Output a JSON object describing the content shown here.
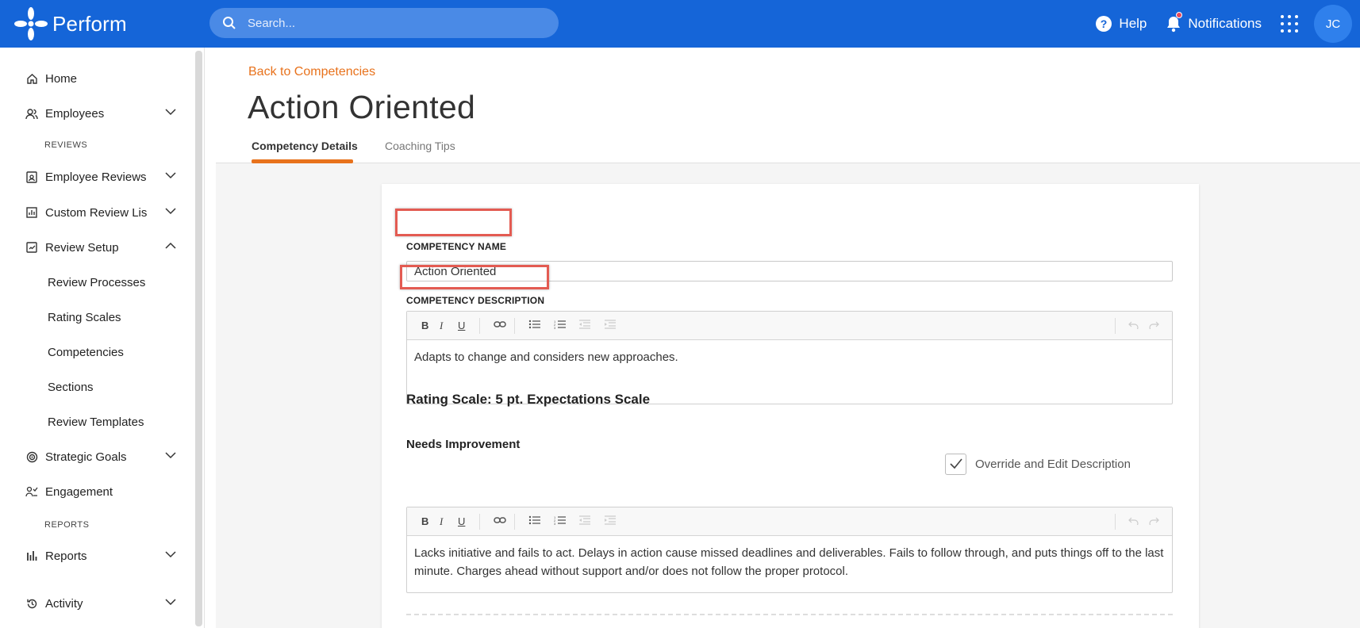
{
  "app": {
    "name": "Perform"
  },
  "search": {
    "placeholder": "Search..."
  },
  "topbar": {
    "help_label": "Help",
    "notifications_label": "Notifications",
    "avatar_initials": "JC"
  },
  "sidebar": {
    "home": "Home",
    "employees": "Employees",
    "section_reviews": "REVIEWS",
    "employee_reviews": "Employee Reviews",
    "custom_review_lists": "Custom Review Lis",
    "review_setup": "Review Setup",
    "review_processes": "Review Processes",
    "rating_scales": "Rating Scales",
    "competencies": "Competencies",
    "sections": "Sections",
    "review_templates": "Review Templates",
    "strategic_goals": "Strategic Goals",
    "engagement": "Engagement",
    "section_reports": "REPORTS",
    "reports": "Reports",
    "activity": "Activity"
  },
  "page": {
    "back_link": "Back to Competencies",
    "title": "Action Oriented",
    "tabs": [
      "Competency Details",
      "Coaching Tips"
    ]
  },
  "form": {
    "name_label": "COMPETENCY NAME",
    "name_value": "Action Oriented",
    "description_label": "COMPETENCY DESCRIPTION",
    "description_text": "Adapts to change and considers new approaches.",
    "rating_scale_heading": "Rating Scale: 5 pt. Expectations Scale",
    "level_name": "Needs Improvement",
    "override_label": "Override and Edit Description",
    "override_checked": true,
    "level_description": "Lacks initiative and fails to act. Delays in action cause missed deadlines and deliverables.  Fails to follow through, and puts things off to the last minute. Charges ahead without support and/or does not follow the proper protocol."
  },
  "colors": {
    "brand": "#1565d8",
    "accent": "#e8721c",
    "highlight": "#e35b52"
  },
  "icons": [
    "search-icon",
    "help-icon",
    "bell-icon",
    "apps-grid-icon",
    "home-icon",
    "people-icon",
    "review-icon",
    "chart-icon",
    "clipboard-icon",
    "target-icon",
    "engagement-icon",
    "bar-chart-icon",
    "history-icon",
    "bold-icon",
    "italic-icon",
    "underline-icon",
    "link-icon",
    "bullet-list-icon",
    "numbered-list-icon",
    "outdent-icon",
    "indent-icon",
    "undo-icon",
    "redo-icon",
    "check-icon"
  ]
}
